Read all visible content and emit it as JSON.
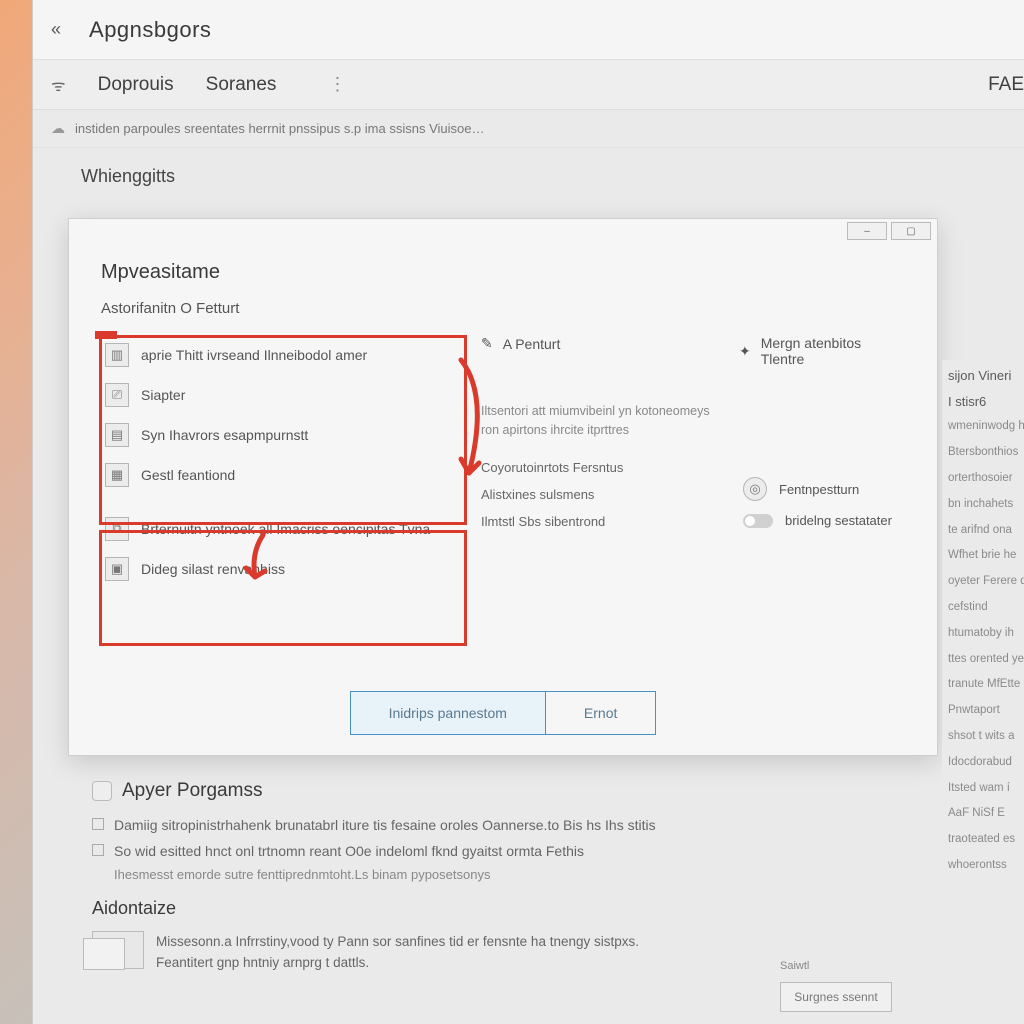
{
  "header": {
    "back_glyph": "«",
    "title": "Apgnsbgors"
  },
  "tabs": {
    "wifi_glyph": "ᯤ",
    "tab1": "Doprouis",
    "tab2": "Soranes",
    "vdots": "⋮",
    "right": "FAE"
  },
  "subtitle": {
    "cloud_glyph": "☁",
    "text": "instiden parpoules sreentates herrnit pnssipus s.p ima ssisns Viuisoe…"
  },
  "section": "Whienggitts",
  "dialog": {
    "minimize": "–",
    "maximize": "▢",
    "title": "Mpveasitame",
    "subtitle": "Astorifanitn O Fetturt",
    "colA": [
      {
        "icon": "▥",
        "label": "aprie Thitt ivrseand Ilnneibodol amer"
      },
      {
        "icon": "⎚",
        "label": "Siapter"
      },
      {
        "icon": "▤",
        "label": "Syn Ihavrors esapmpurnstt"
      },
      {
        "icon": "▦",
        "label": "Gestl feantiond"
      },
      {
        "icon": "⧉",
        "label": "Brternuitn yntnoek all Imacriss oencipitas Tvna"
      },
      {
        "icon": "▣",
        "label": "Dideg silast renvanhiss"
      }
    ],
    "colB": {
      "head_icon": "✎",
      "head": "A Penturt",
      "text": "Iltsentori att miumvibeinl yn kotoneomeys ron apirtons ihrcite itprttres",
      "items": [
        "Coyorutoinrtots Fersntus",
        "Alistxines sulsmens",
        "Ilmtstl Sbs sibentrond"
      ]
    },
    "colC": {
      "head_icon": "✦",
      "head": "Mergn atenbitos Tlentre",
      "items": [
        {
          "icon": "◎",
          "label": "Fentnpestturn"
        },
        {
          "toggle": true,
          "label": "bridelng  sestatater"
        }
      ]
    },
    "buttons": {
      "primary": "Inidrips pannestom",
      "secondary": "Ernot"
    }
  },
  "lower": {
    "heading": "Apyer Porgamss",
    "b1": "Damiig sitropinistrhahenk brunatabrl iture tis fesaine oroles Oannerse.to Bis hs Ihs stitis",
    "b2": "So wid esitted hnct onl trtnomn reant O0e indeloml fknd gyaitst ormta Fethis",
    "sub": "Ihesmesst emorde sutre fenttiprednmtoht.Ls binam pyposetsonys",
    "heading2": "Aidontaize",
    "desc1": "Missesonn.a Infrrstiny,vood ty Pann sor sanfines tid er fensnte ha tnengy sistpxs.",
    "desc2": "Feantitert gnp hntniy arnprg t dattls."
  },
  "right": {
    "head1": "sijon Vineri",
    "head2": "I stisr6",
    "lines": [
      "wmeninwodg hn",
      "Btersbonthios",
      "orterthosoier",
      "bn inchahets",
      "te arifnd ona",
      "Wfhet brie he",
      "oyeter Ferere d",
      "cefstind",
      "htumatoby ih",
      "ttes orented ye",
      "tranute MfEtte",
      "Pnwtaport",
      "shsot t wits a",
      "Idocdorabud",
      "Itsted wam í",
      "AaF NiSf E",
      "traoteated es",
      "whoerontss"
    ]
  },
  "save": {
    "label": "Saiwtl",
    "button": "Surgnes ssennt"
  }
}
